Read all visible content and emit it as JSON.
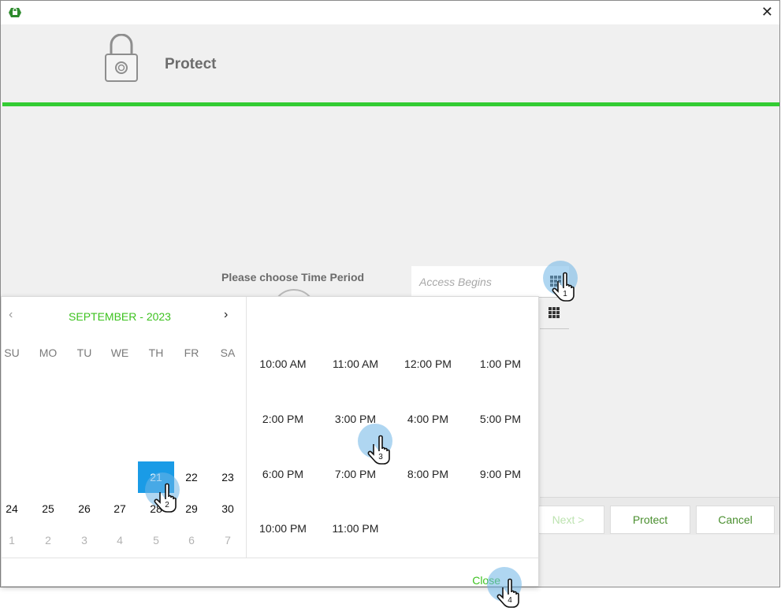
{
  "header": {
    "title": "Protect"
  },
  "form": {
    "period_label": "Please choose Time Period",
    "access_begins_placeholder": "Access Begins"
  },
  "footer": {
    "next_label": "Next >",
    "protect_label": "Protect",
    "cancel_label": "Cancel"
  },
  "calendar": {
    "month_label": "SEPTEMBER - 2023",
    "weekdays": [
      "SU",
      "MO",
      "TU",
      "WE",
      "TH",
      "FR",
      "SA"
    ],
    "row4": [
      "21",
      "22",
      "23"
    ],
    "row5": [
      "24",
      "25",
      "26",
      "27",
      "28",
      "29",
      "30"
    ],
    "row6": [
      "1",
      "2",
      "3",
      "4",
      "5",
      "6",
      "7"
    ],
    "selected_day": "21"
  },
  "times": [
    [
      "10:00 AM",
      "11:00 AM",
      "12:00 PM",
      "1:00 PM"
    ],
    [
      "2:00 PM",
      "3:00 PM",
      "4:00 PM",
      "5:00 PM"
    ],
    [
      "6:00 PM",
      "7:00 PM",
      "8:00 PM",
      "9:00 PM"
    ],
    [
      "10:00 PM",
      "11:00 PM"
    ]
  ],
  "picker": {
    "close_label": "Close"
  },
  "steps": [
    "1",
    "2",
    "3",
    "4"
  ],
  "colors": {
    "accent_green": "#33cc33",
    "selected_blue": "#1a9be6"
  },
  "icons": {
    "app": "app-logo-icon",
    "close": "close-icon",
    "lock": "lock-icon",
    "calendar": "calendar-grid-icon",
    "hand": "hand-pointer-icon"
  }
}
